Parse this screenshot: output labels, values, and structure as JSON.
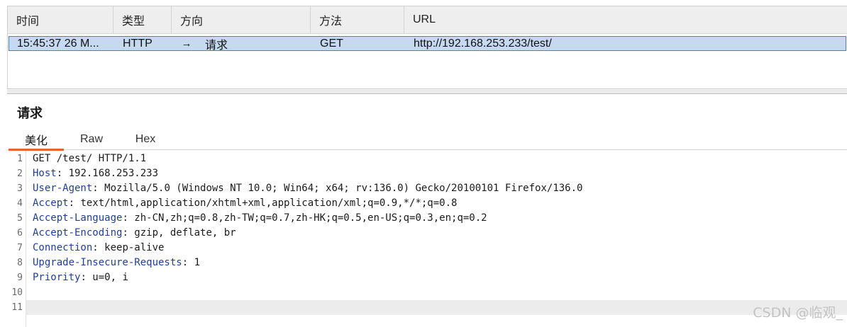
{
  "history": {
    "columns": [
      "时间",
      "类型",
      "方向",
      "方法",
      "URL"
    ],
    "rows": [
      {
        "time": "15:45:37 26 M...",
        "type": "HTTP",
        "direction_icon": "right-arrow-icon",
        "direction_glyph": "→",
        "direction": "请求",
        "method": "GET",
        "url": "http://192.168.253.233/test/"
      }
    ]
  },
  "panel": {
    "title": "请求",
    "tabs": [
      {
        "label": "美化",
        "active": true
      },
      {
        "label": "Raw",
        "active": false
      },
      {
        "label": "Hex",
        "active": false
      }
    ]
  },
  "editor": {
    "lines": [
      {
        "num": "1",
        "name": "",
        "sep": "",
        "value": "GET /test/ HTTP/1.1"
      },
      {
        "num": "2",
        "name": "Host",
        "sep": ":",
        "value": " 192.168.253.233"
      },
      {
        "num": "3",
        "name": "User-Agent",
        "sep": ":",
        "value": " Mozilla/5.0 (Windows NT 10.0; Win64; x64; rv:136.0) Gecko/20100101 Firefox/136.0"
      },
      {
        "num": "4",
        "name": "Accept",
        "sep": ":",
        "value": " text/html,application/xhtml+xml,application/xml;q=0.9,*/*;q=0.8"
      },
      {
        "num": "5",
        "name": "Accept-Language",
        "sep": ":",
        "value": " zh-CN,zh;q=0.8,zh-TW;q=0.7,zh-HK;q=0.5,en-US;q=0.3,en;q=0.2"
      },
      {
        "num": "6",
        "name": "Accept-Encoding",
        "sep": ":",
        "value": " gzip, deflate, br"
      },
      {
        "num": "7",
        "name": "Connection",
        "sep": ":",
        "value": " keep-alive"
      },
      {
        "num": "8",
        "name": "Upgrade-Insecure-Requests",
        "sep": ":",
        "value": " 1"
      },
      {
        "num": "9",
        "name": "Priority",
        "sep": ":",
        "value": " u=0, i"
      },
      {
        "num": "10",
        "name": "",
        "sep": "",
        "value": ""
      },
      {
        "num": "11",
        "name": "",
        "sep": "",
        "value": ""
      }
    ],
    "current_line": "11"
  },
  "watermark": "CSDN @临观_",
  "colors": {
    "selected_row_bg": "#c7d9ef",
    "selected_row_border": "#4a7fc1",
    "active_tab_underline": "#e8642a",
    "header_name": "#1f3f9c"
  }
}
